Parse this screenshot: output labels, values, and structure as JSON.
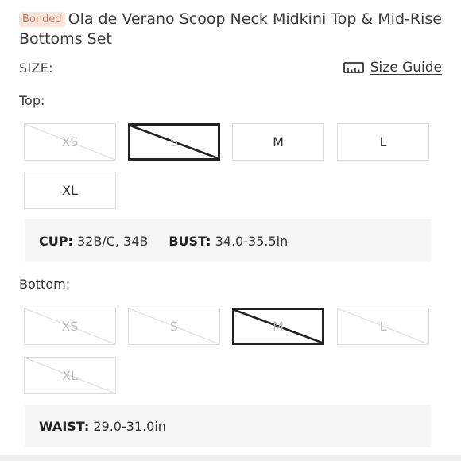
{
  "listing": {
    "badge": "Bonded",
    "title": "Ola de Verano Scoop Neck Midkini Top & Mid-Rise Bottoms Set"
  },
  "size": {
    "label": "SIZE:",
    "guide_label": "Size Guide",
    "guide_icon": "ruler-icon"
  },
  "top": {
    "label": "Top:",
    "sizes": [
      {
        "label": "XS",
        "state": "unavailable"
      },
      {
        "label": "S",
        "state": "selected-unavailable"
      },
      {
        "label": "M",
        "state": "available"
      },
      {
        "label": "L",
        "state": "available"
      },
      {
        "label": "XL",
        "state": "available"
      }
    ],
    "info": {
      "cup_key": "CUP:",
      "cup_value": "32B/C, 34B",
      "bust_key": "BUST:",
      "bust_value": "34.0-35.5in"
    }
  },
  "bottom": {
    "label": "Bottom:",
    "sizes": [
      {
        "label": "XS",
        "state": "unavailable"
      },
      {
        "label": "S",
        "state": "unavailable"
      },
      {
        "label": "M",
        "state": "selected-unavailable"
      },
      {
        "label": "L",
        "state": "unavailable"
      },
      {
        "label": "XL",
        "state": "unavailable"
      }
    ],
    "info": {
      "waist_key": "WAIST:",
      "waist_value": "29.0-31.0in"
    }
  },
  "colors": {
    "badge_bg": "#fbe6dc",
    "badge_text": "#b97a5e",
    "selected_border": "#222222",
    "disabled_border": "#dddddd",
    "info_bg": "#f6f6f6"
  }
}
